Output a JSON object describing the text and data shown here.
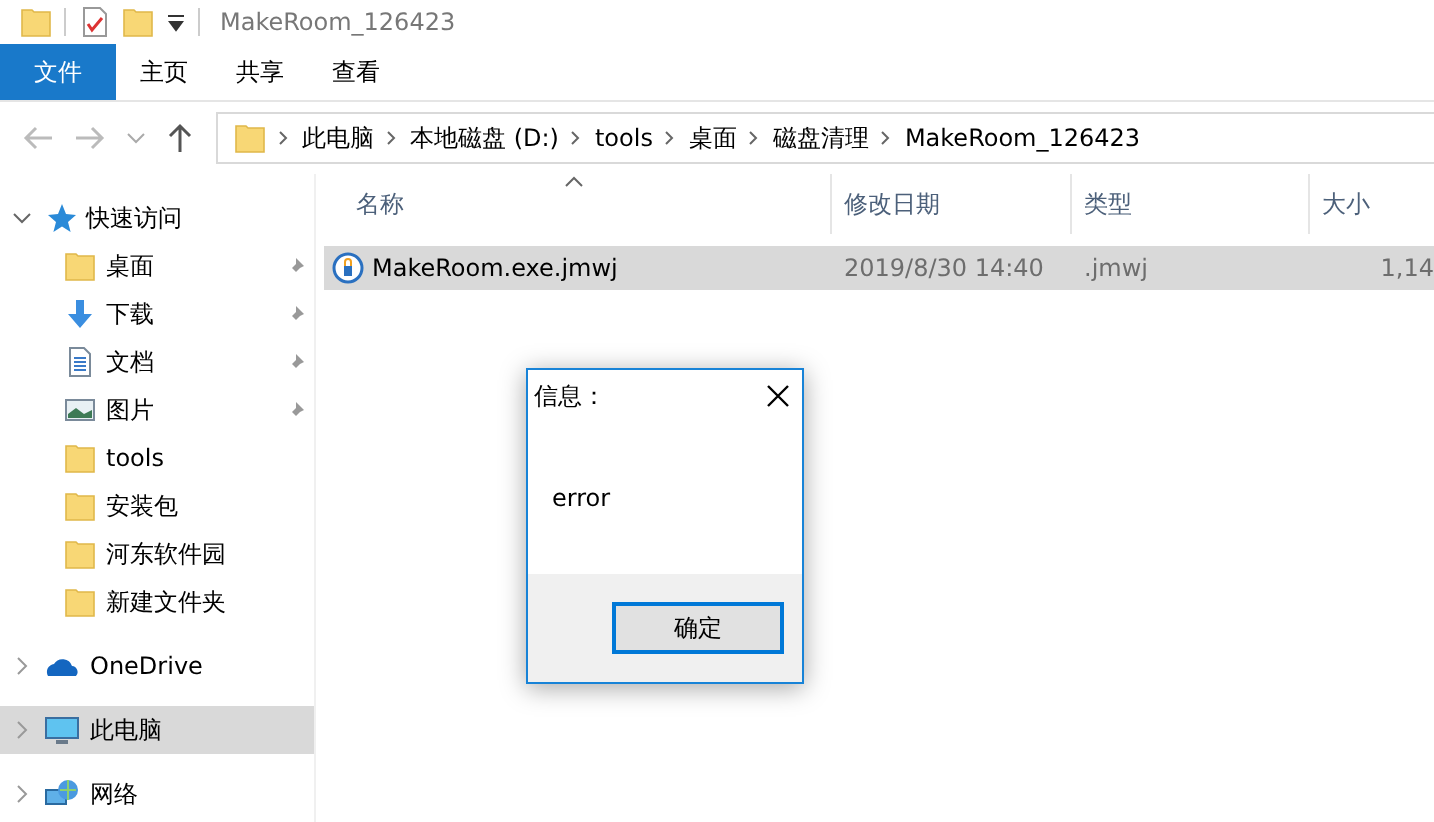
{
  "window": {
    "title": "MakeRoom_126423"
  },
  "ribbon_tabs": [
    {
      "label": "文件",
      "kind": "file",
      "selected": false
    },
    {
      "label": "主页",
      "kind": "tab",
      "selected": false
    },
    {
      "label": "共享",
      "kind": "tab",
      "selected": false
    },
    {
      "label": "查看",
      "kind": "tab",
      "selected": false
    }
  ],
  "address": {
    "segments": [
      "此电脑",
      "本地磁盘 (D:)",
      "tools",
      "桌面",
      "磁盘清理",
      "MakeRoom_126423"
    ]
  },
  "sidebar": {
    "items": [
      {
        "label": "快速访问",
        "kind": "star",
        "expanded": true,
        "selected": false,
        "children": [
          {
            "label": "桌面",
            "kind": "folder",
            "pinned": true,
            "selected": false
          },
          {
            "label": "下载",
            "kind": "download",
            "pinned": true,
            "selected": false
          },
          {
            "label": "文档",
            "kind": "document",
            "pinned": true,
            "selected": false
          },
          {
            "label": "图片",
            "kind": "image",
            "pinned": true,
            "selected": false
          },
          {
            "label": "tools",
            "kind": "folder",
            "pinned": false,
            "selected": false
          },
          {
            "label": "安装包",
            "kind": "folder",
            "pinned": false,
            "selected": false
          },
          {
            "label": "河东软件园",
            "kind": "folder",
            "pinned": false,
            "selected": false
          },
          {
            "label": "新建文件夹",
            "kind": "folder",
            "pinned": false,
            "selected": false
          }
        ]
      },
      {
        "label": "OneDrive",
        "kind": "cloud",
        "expanded": false,
        "selected": false
      },
      {
        "label": "此电脑",
        "kind": "computer",
        "expanded": false,
        "selected": true
      },
      {
        "label": "网络",
        "kind": "network",
        "expanded": false,
        "selected": false
      }
    ]
  },
  "table": {
    "columns": [
      {
        "label": "名称",
        "sorted": true
      },
      {
        "label": "修改日期",
        "sorted": false
      },
      {
        "label": "类型",
        "sorted": false
      },
      {
        "label": "大小",
        "sorted": false
      }
    ],
    "rows": [
      {
        "cells": [
          "MakeRoom.exe.jmwj",
          "2019/8/30 14:40",
          ".jmwj",
          "1,14"
        ],
        "selected": true
      }
    ]
  },
  "dialog": {
    "title": "信息：",
    "message": "error",
    "button": "确定"
  }
}
